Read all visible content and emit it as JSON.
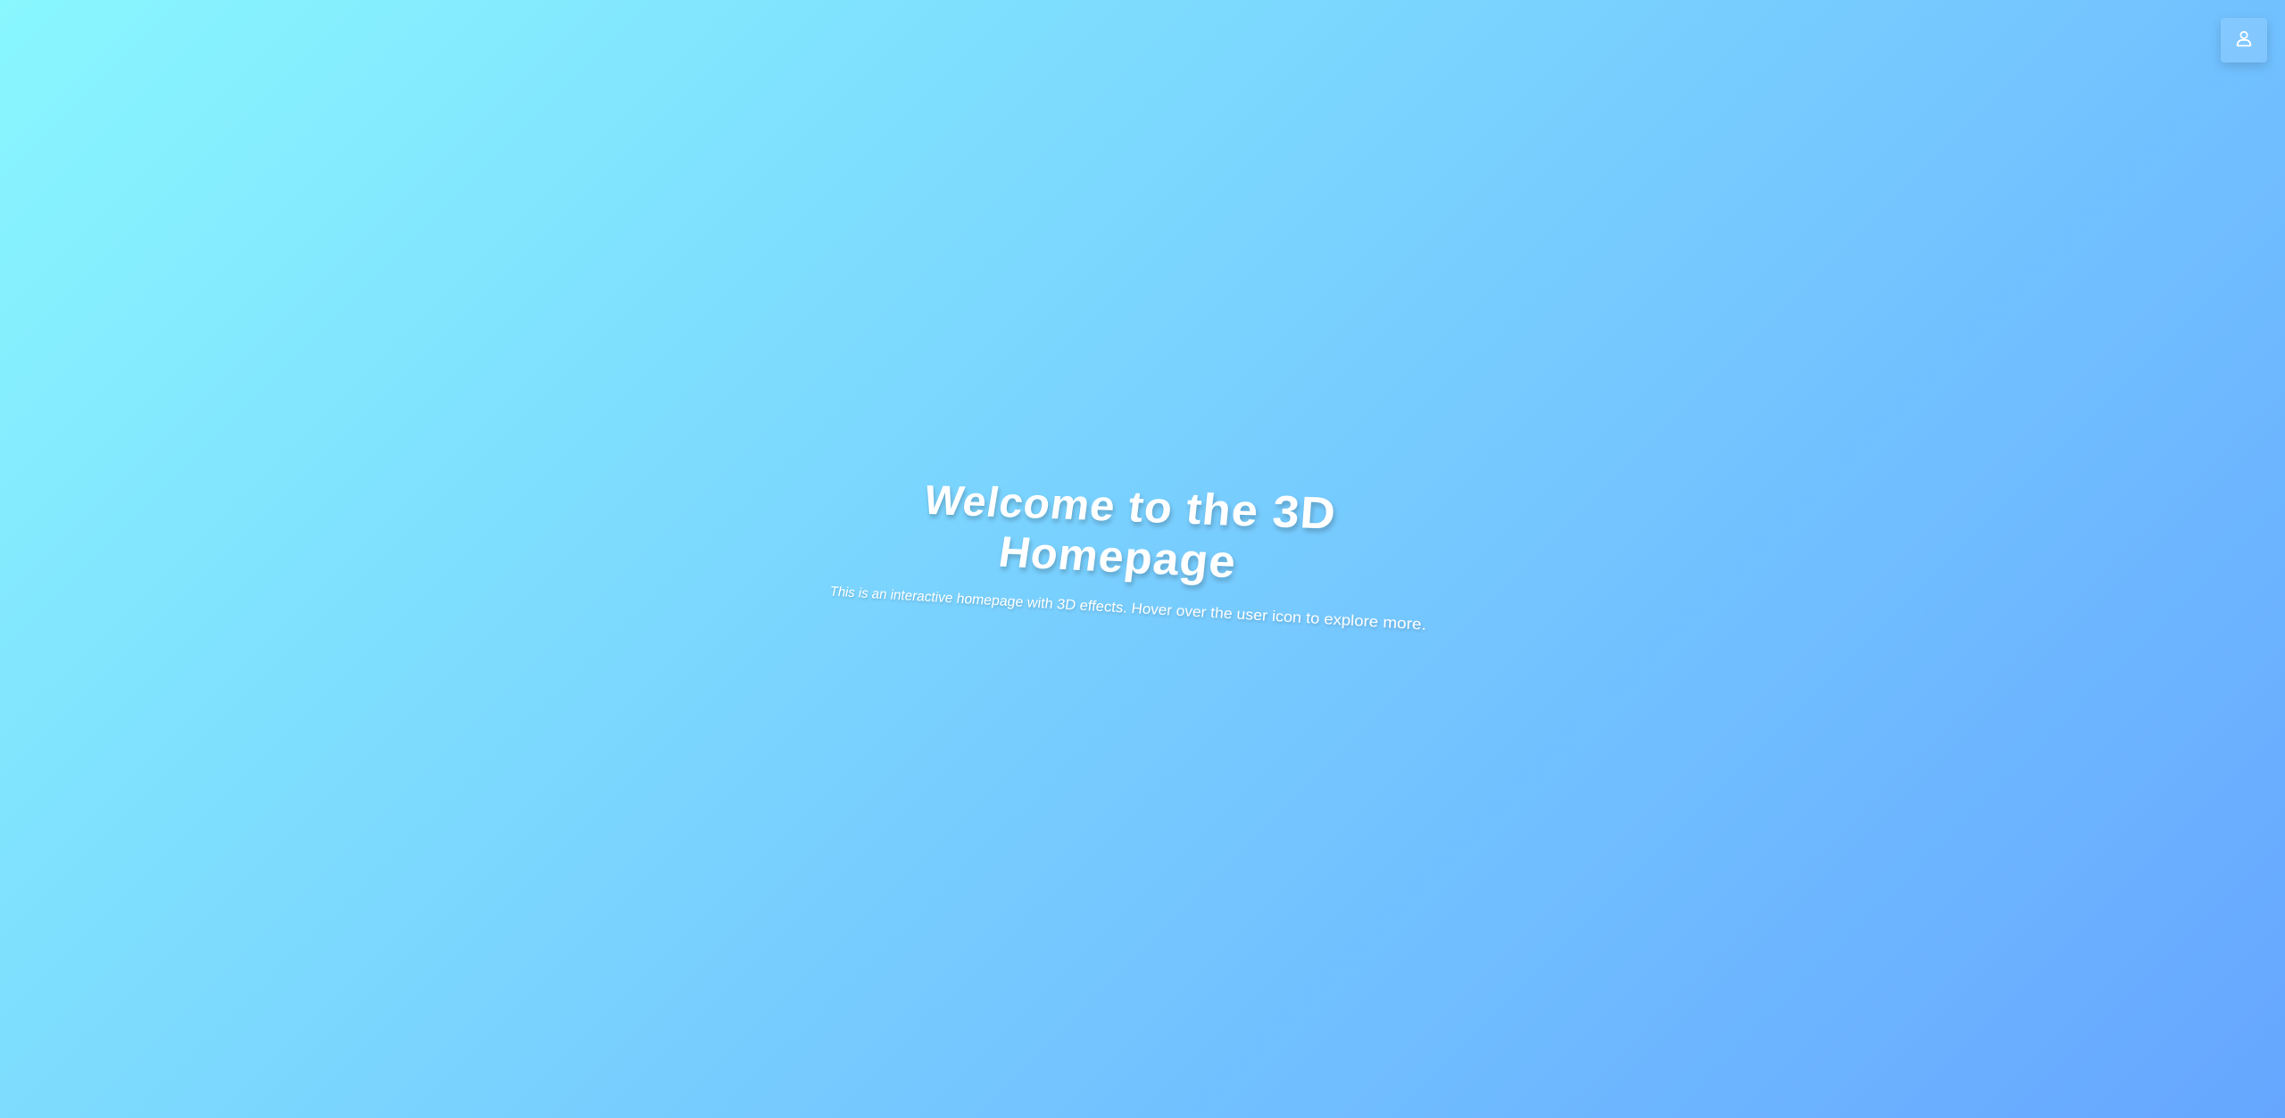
{
  "header": {
    "user_icon": "user-icon"
  },
  "hero": {
    "title": "Welcome to the 3D Homepage",
    "subtitle": "This is an interactive homepage with 3D effects. Hover over the user icon to explore more."
  },
  "colors": {
    "gradient_start": "#89f7fe",
    "gradient_end": "#66a6ff",
    "text": "#ffffff"
  }
}
